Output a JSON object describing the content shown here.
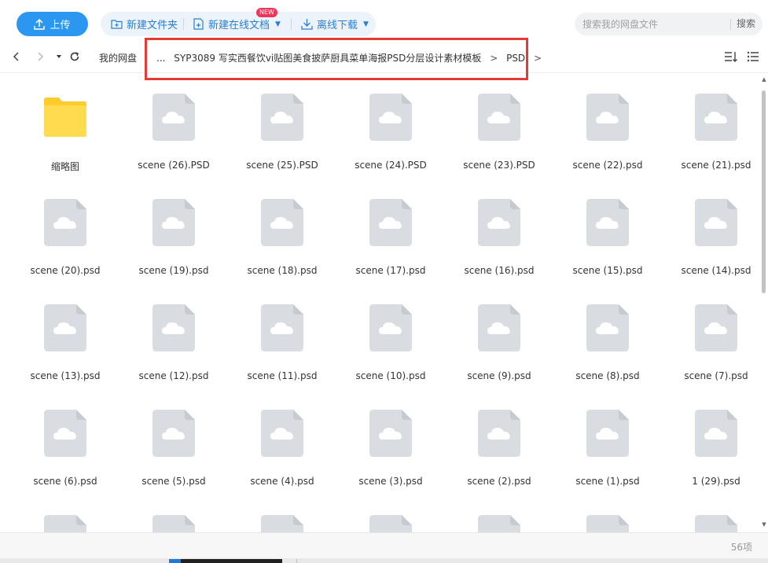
{
  "toolbar": {
    "upload_label": "上传",
    "new_folder_label": "新建文件夹",
    "new_online_doc_label": "新建在线文档",
    "new_badge": "NEW",
    "offline_download_label": "离线下载",
    "search_placeholder": "搜索我的网盘文件",
    "search_button": "搜索",
    "accent_color": "#2b97f0"
  },
  "breadcrumb": {
    "root": "我的网盘",
    "ellipsis": "...",
    "folder": "SYP3089 写实西餐饮vi贴图美食披萨厨具菜单海报PSD分层设计素材模板",
    "current": "PSD",
    "separator": ">"
  },
  "files": [
    {
      "name": "缩略图",
      "type": "folder"
    },
    {
      "name": "scene (26).PSD",
      "type": "file"
    },
    {
      "name": "scene (25).PSD",
      "type": "file"
    },
    {
      "name": "scene (24).PSD",
      "type": "file"
    },
    {
      "name": "scene (23).PSD",
      "type": "file"
    },
    {
      "name": "scene (22).psd",
      "type": "file"
    },
    {
      "name": "scene (21).psd",
      "type": "file"
    },
    {
      "name": "scene (20).psd",
      "type": "file"
    },
    {
      "name": "scene (19).psd",
      "type": "file"
    },
    {
      "name": "scene (18).psd",
      "type": "file"
    },
    {
      "name": "scene (17).psd",
      "type": "file"
    },
    {
      "name": "scene (16).psd",
      "type": "file"
    },
    {
      "name": "scene (15).psd",
      "type": "file"
    },
    {
      "name": "scene (14).psd",
      "type": "file"
    },
    {
      "name": "scene (13).psd",
      "type": "file"
    },
    {
      "name": "scene (12).psd",
      "type": "file"
    },
    {
      "name": "scene (11).psd",
      "type": "file"
    },
    {
      "name": "scene (10).psd",
      "type": "file"
    },
    {
      "name": "scene (9).psd",
      "type": "file"
    },
    {
      "name": "scene (8).psd",
      "type": "file"
    },
    {
      "name": "scene (7).psd",
      "type": "file"
    },
    {
      "name": "scene (6).psd",
      "type": "file"
    },
    {
      "name": "scene (5).psd",
      "type": "file"
    },
    {
      "name": "scene (4).psd",
      "type": "file"
    },
    {
      "name": "scene (3).psd",
      "type": "file"
    },
    {
      "name": "scene (2).psd",
      "type": "file"
    },
    {
      "name": "scene (1).psd",
      "type": "file"
    },
    {
      "name": "1 (29).psd",
      "type": "file"
    },
    {
      "name": "",
      "type": "file"
    },
    {
      "name": "",
      "type": "file"
    },
    {
      "name": "",
      "type": "file"
    },
    {
      "name": "",
      "type": "file"
    },
    {
      "name": "",
      "type": "file"
    },
    {
      "name": "",
      "type": "file"
    },
    {
      "name": "",
      "type": "file"
    }
  ],
  "status": {
    "count": "56项"
  },
  "icons": {
    "upload": "upload-icon",
    "new_folder": "folder-plus-icon",
    "new_doc": "doc-plus-icon",
    "download": "download-icon",
    "back": "back-icon",
    "forward": "forward-icon",
    "history": "history-dropdown-icon",
    "refresh": "refresh-icon",
    "sort": "sort-icon",
    "list_view": "list-view-icon",
    "folder": "folder-icon",
    "file_cloud": "cloud-file-icon"
  },
  "colors": {
    "highlight_box": "#e53935",
    "folder": "#ffd84d",
    "file_icon": "#d7dbe0"
  }
}
